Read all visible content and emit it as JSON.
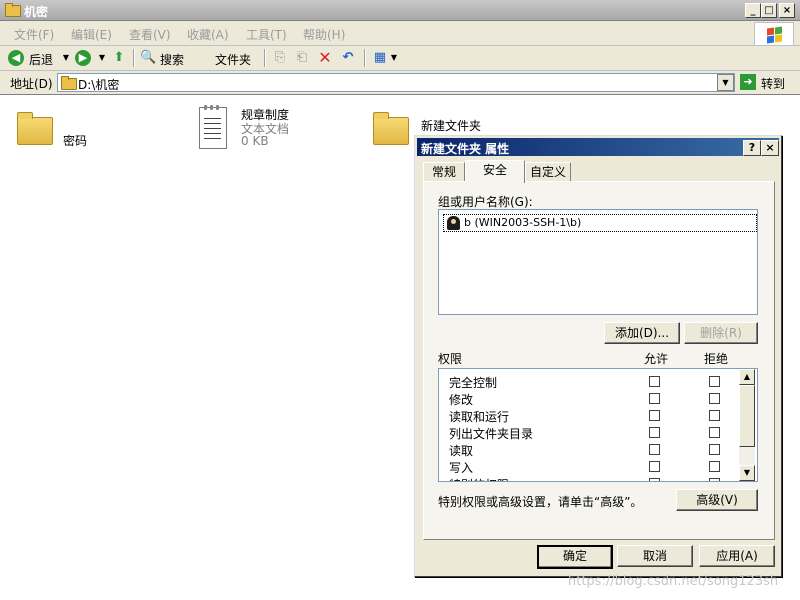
{
  "window": {
    "title": "机密"
  },
  "menu": [
    "文件(F)",
    "编辑(E)",
    "查看(V)",
    "收藏(A)",
    "工具(T)",
    "帮助(H)"
  ],
  "toolbar": {
    "back_label": "后退",
    "search_label": "搜索",
    "folders_label": "文件夹"
  },
  "address": {
    "label": "地址(D)",
    "value": "D:\\机密",
    "go_label": "转到"
  },
  "files": [
    {
      "name": "密码",
      "type": "folder"
    },
    {
      "name": "规章制度",
      "type": "text",
      "subtitle": "文本文档",
      "size": "0 KB"
    },
    {
      "name": "新建文件夹",
      "type": "folder"
    }
  ],
  "dialog": {
    "title": "新建文件夹 属性",
    "help_glyph": "?",
    "close_glyph": "×",
    "tabs": [
      "常规",
      "安全",
      "自定义"
    ],
    "active_tab": "安全",
    "group_label": "组或用户名称(G):",
    "users": [
      "b (WIN2003-SSH-1\\b)"
    ],
    "add_button": "添加(D)...",
    "remove_button": "删除(R)",
    "perm_header": "权限",
    "allow_header": "允许",
    "deny_header": "拒绝",
    "permissions": [
      {
        "name": "完全控制",
        "allow": false,
        "deny": false
      },
      {
        "name": "修改",
        "allow": false,
        "deny": false
      },
      {
        "name": "读取和运行",
        "allow": false,
        "deny": false
      },
      {
        "name": "列出文件夹目录",
        "allow": false,
        "deny": false
      },
      {
        "name": "读取",
        "allow": false,
        "deny": false
      },
      {
        "name": "写入",
        "allow": false,
        "deny": false
      },
      {
        "name": "特别的权限",
        "allow": false,
        "deny": false
      }
    ],
    "advanced_hint": "特别权限或高级设置，请单击“高级”。",
    "advanced_button": "高级(V)",
    "ok_button": "确定",
    "cancel_button": "取消",
    "apply_button": "应用(A)"
  },
  "watermark": "https://blog.csdn.net/song123sh"
}
